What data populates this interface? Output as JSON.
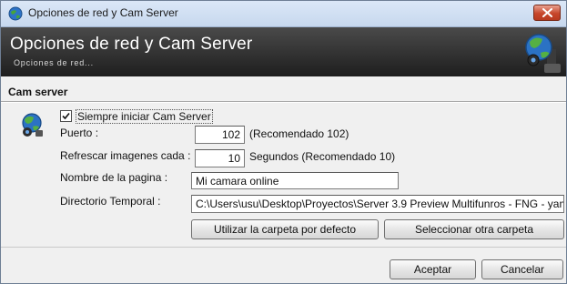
{
  "window": {
    "title": "Opciones de red y Cam Server",
    "close_icon": "close-icon"
  },
  "banner": {
    "title": "Opciones de red y Cam Server",
    "subtitle": "Opciones de red...",
    "icon": "network-globe-icon"
  },
  "section": {
    "title": "Cam server",
    "icon": "network-globe-icon"
  },
  "form": {
    "always_start": {
      "label": "Siempre iniciar Cam Server",
      "checked": true
    },
    "port": {
      "label": "Puerto :",
      "value": "102",
      "hint": "(Recomendado 102)"
    },
    "refresh": {
      "label": "Refrescar imagenes cada :",
      "value": "10",
      "hint": "Segundos (Recomendado 10)"
    },
    "page_name": {
      "label": "Nombre de la pagina :",
      "value": "Mi camara online"
    },
    "temp_dir": {
      "label": "Directorio Temporal :",
      "value": "C:\\Users\\usu\\Desktop\\Proyectos\\Server 3.9 Preview Multifunros - FNG - yam"
    },
    "use_default_button": "Utilizar la carpeta por defecto",
    "select_folder_button": "Seleccionar otra carpeta"
  },
  "footer": {
    "accept_button": "Aceptar",
    "cancel_button": "Cancelar"
  }
}
